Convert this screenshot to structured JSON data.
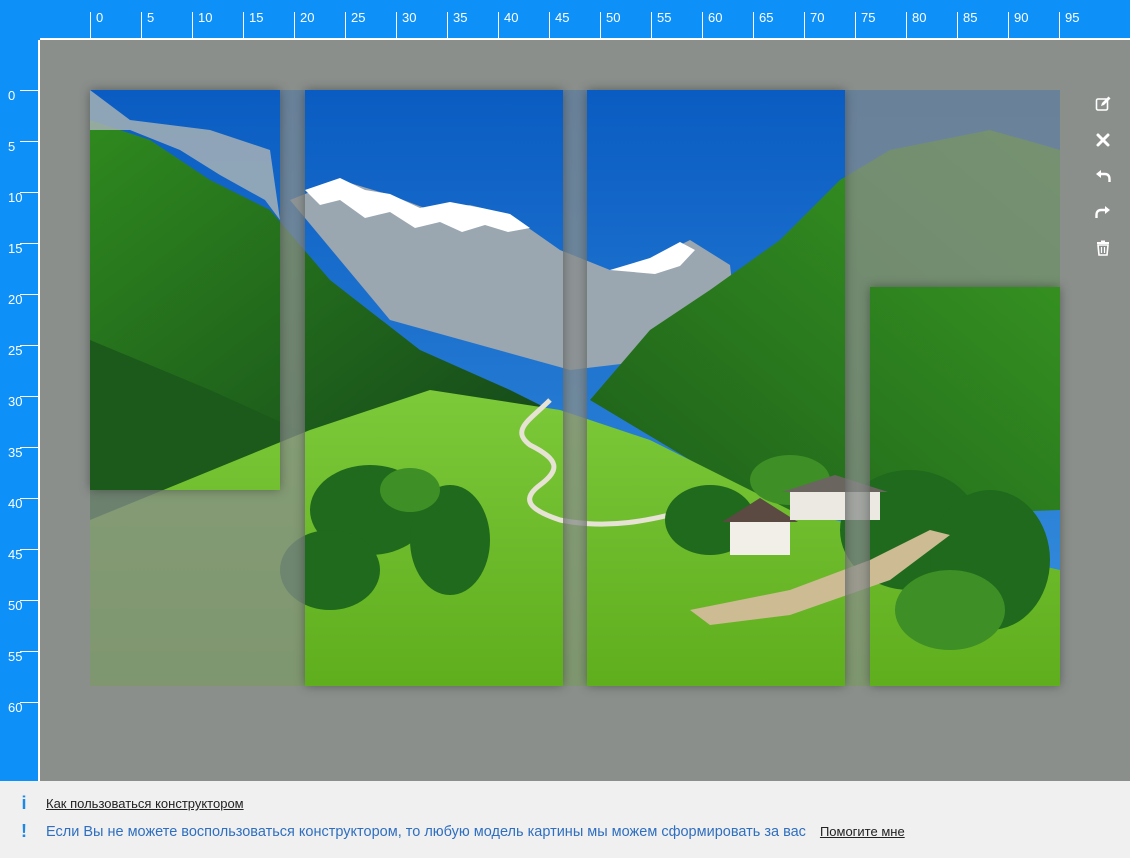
{
  "ruler": {
    "top_labels": [
      "0",
      "5",
      "10",
      "15",
      "20",
      "25",
      "30",
      "35",
      "40",
      "45",
      "50",
      "55",
      "60",
      "65",
      "70",
      "75",
      "80",
      "85",
      "90",
      "95"
    ],
    "left_labels": [
      "0",
      "5",
      "10",
      "15",
      "20",
      "25",
      "30",
      "35",
      "40",
      "45",
      "50",
      "55",
      "60"
    ]
  },
  "toolbar": {
    "items": [
      {
        "name": "edit-icon"
      },
      {
        "name": "close-icon"
      },
      {
        "name": "undo-icon"
      },
      {
        "name": "redo-icon"
      },
      {
        "name": "trash-icon"
      }
    ]
  },
  "footer": {
    "how_to_link": "Как пользоваться конструктором",
    "message": "Если Вы не можете воспользоваться конструктором, то любую модель картины мы можем сформировать за вас",
    "help_link": "Помогите мне"
  },
  "colors": {
    "ruler": "#0d90f7",
    "canvas": "#8a8f8c",
    "footer_bg": "#f0f0f0",
    "info_icon": "#1e88e5",
    "message_text": "#2f6fc0"
  }
}
